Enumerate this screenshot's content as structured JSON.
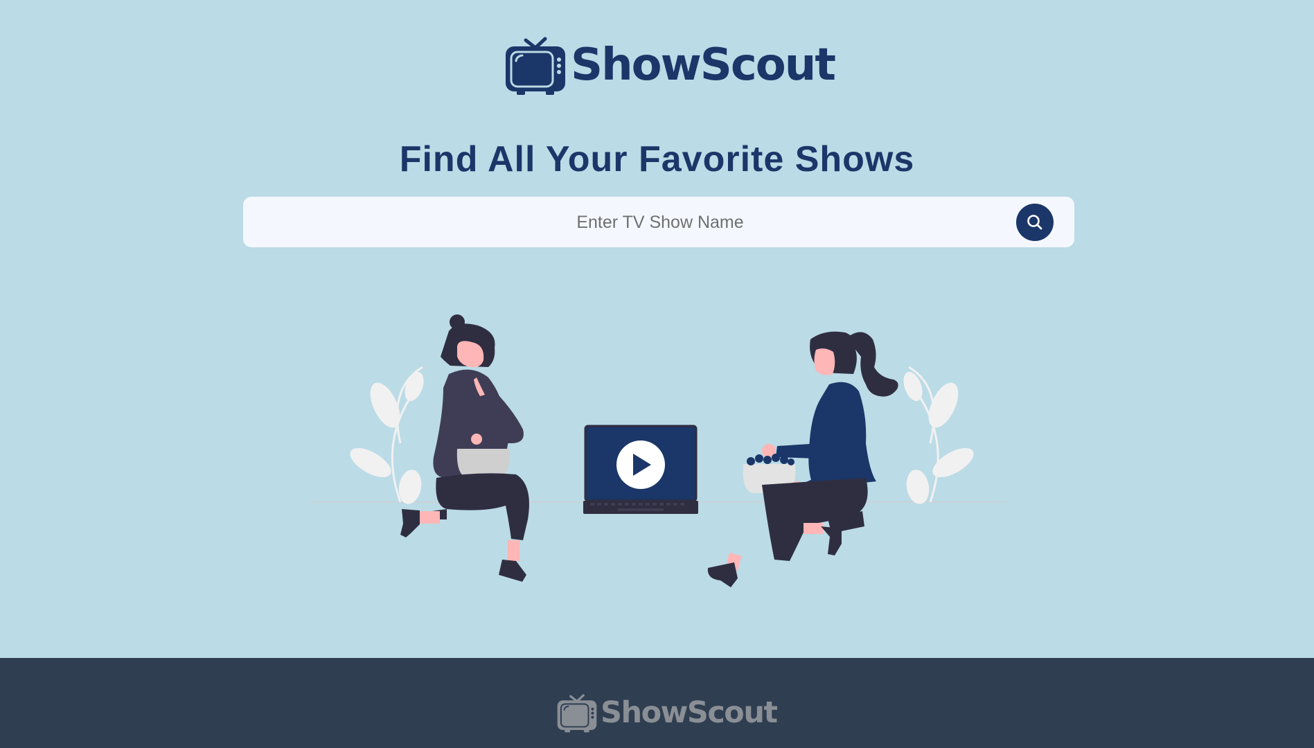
{
  "brand": {
    "name": "ShowScout",
    "primary_color": "#1b3668",
    "background_color": "#bbdbe6"
  },
  "header": {
    "logo_text": "ShowScout",
    "logo_icon": "tv-icon"
  },
  "hero": {
    "headline": "Find All Your Favorite Shows"
  },
  "search": {
    "placeholder": "Enter TV Show Name",
    "value": "",
    "button_icon": "search-icon"
  },
  "illustration": {
    "description_icon": "people-watching-laptop-illustration",
    "center_icon": "play-icon"
  },
  "footer": {
    "logo_text": "ShowScout",
    "logo_icon": "tv-icon",
    "background_color": "#2f3e50"
  }
}
